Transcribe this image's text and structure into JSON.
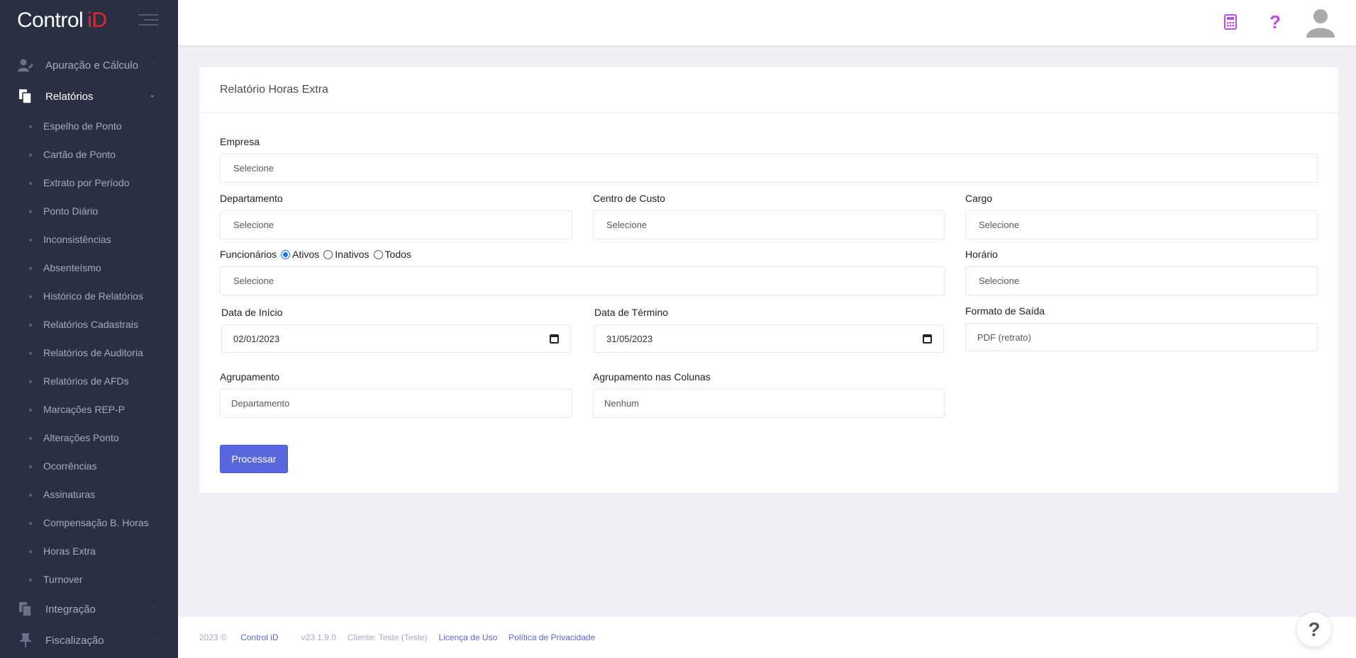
{
  "brand": {
    "name": "Control",
    "id": "iD"
  },
  "sidebar": {
    "top_items": [
      {
        "label": "Apuração e Cálculo"
      },
      {
        "label": "Relatórios"
      }
    ],
    "sub_items": [
      "Espelho de Ponto",
      "Cartão de Ponto",
      "Extrato por Período",
      "Ponto Diário",
      "Inconsistências",
      "Absenteísmo",
      "Histórico de Relatórios",
      "Relatórios Cadastrais",
      "Relatórios de Auditoria",
      "Relatórios de AFDs",
      "Marcações REP-P",
      "Alterações Ponto",
      "Ocorrências",
      "Assinaturas",
      "Compensação B. Horas",
      "Horas Extra",
      "Turnover"
    ],
    "bottom_items": [
      {
        "label": "Integração"
      },
      {
        "label": "Fiscalização"
      }
    ]
  },
  "header": {
    "help_glyph": "?"
  },
  "card": {
    "title": "Relatório Horas Extra",
    "empresa": {
      "label": "Empresa",
      "value": "Selecione"
    },
    "departamento": {
      "label": "Departamento",
      "value": "Selecione"
    },
    "centro_custo": {
      "label": "Centro de Custo",
      "value": "Selecione"
    },
    "cargo": {
      "label": "Cargo",
      "value": "Selecione"
    },
    "funcionarios": {
      "label": "Funcionários",
      "options": [
        "Ativos",
        "Inativos",
        "Todos"
      ],
      "selected": "Ativos",
      "value": "Selecione"
    },
    "horario": {
      "label": "Horário",
      "value": "Selecione"
    },
    "data_inicio": {
      "label": "Data de Início",
      "value": "02/01/2023"
    },
    "data_termino": {
      "label": "Data de Término",
      "value": "31/05/2023"
    },
    "formato_saida": {
      "label": "Formato de Saída",
      "value": "PDF (retrato)"
    },
    "agrupamento": {
      "label": "Agrupamento",
      "value": "Departamento"
    },
    "agrupamento_colunas": {
      "label": "Agrupamento nas Colunas",
      "value": "Nenhum"
    },
    "submit_label": "Processar"
  },
  "footer": {
    "copyright": "2023 ©",
    "brand_link": "Control iD",
    "version": "v23.1.9.0",
    "client": "Cliente: Teste (Teste)",
    "license_link": "Licença de Uso",
    "privacy_link": "Política de Privacidade"
  },
  "help_fab": "?",
  "colors": {
    "sidebar_bg": "#2a2f43",
    "accent": "#5867dd",
    "brand_red": "#e3262f",
    "icon_purple": "#b84fe0"
  }
}
